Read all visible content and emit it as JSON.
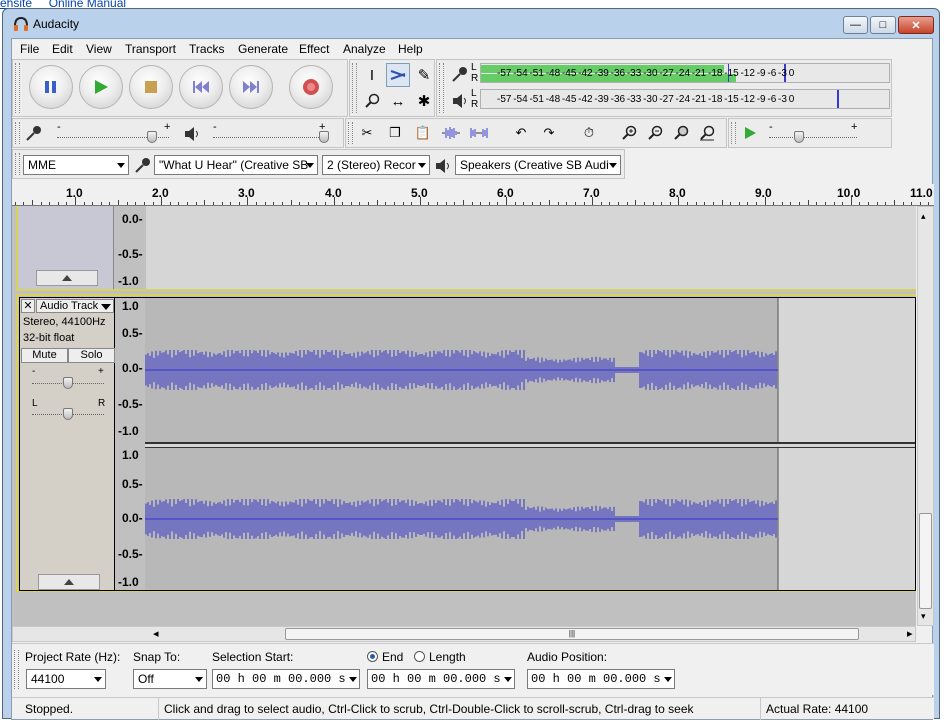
{
  "background": {
    "link_text": "ehsite     Online Manual"
  },
  "window": {
    "title": "Audacity",
    "btn_min": "—",
    "btn_max": "□",
    "btn_close": "✕"
  },
  "menu": [
    "File",
    "Edit",
    "View",
    "Transport",
    "Tracks",
    "Generate",
    "Effect",
    "Analyze",
    "Help"
  ],
  "meters": {
    "rec_ticks": "-57 -54 -51 -48 -45 -42 -39 -36 -33 -30 -27 -24 -21 -18 -15 -12  -9   -6   -3   0",
    "play_ticks": "-57 -54 -51 -48 -45 -42 -39 -36 -33 -30 -27 -24 -21 -18 -15 -12  -9   -6   -3   0",
    "rec_l": "L",
    "rec_r": "R",
    "play_l": "L",
    "play_r": "R"
  },
  "mixer": {
    "plus": "+",
    "minus": "-"
  },
  "devices": {
    "host": "MME",
    "input": "\"What U Hear\" (Creative SB",
    "channels": "2 (Stereo) Recor",
    "output": "Speakers (Creative SB Audi"
  },
  "ruler": {
    "labels": [
      "1.0",
      "2.0",
      "3.0",
      "4.0",
      "5.0",
      "6.0",
      "7.0",
      "8.0",
      "9.0",
      "10.0",
      "11.0"
    ]
  },
  "track1": {
    "scale": [
      "0.0-",
      "-0.5-",
      "-1.0"
    ]
  },
  "track2": {
    "close": "✕",
    "name": "Audio Track",
    "rate": "Stereo, 44100Hz",
    "format": "32-bit float",
    "mute": "Mute",
    "solo": "Solo",
    "gain_minus": "-",
    "gain_plus": "+",
    "pan_l": "L",
    "pan_r": "R",
    "scale_top": [
      "1.0",
      "0.5-",
      "0.0-",
      "-0.5-",
      "-1.0"
    ],
    "scale_bottom": [
      "1.0",
      "0.5-",
      "0.0-",
      "-0.5-",
      "-1.0"
    ]
  },
  "hscroll": {
    "left": "◂",
    "right": "▸",
    "grip": "|||"
  },
  "selection": {
    "rate_label": "Project Rate (Hz):",
    "rate_value": "44100",
    "snap_label": "Snap To:",
    "snap_value": "Off",
    "start_label": "Selection Start:",
    "end_label": "End",
    "length_label": "Length",
    "pos_label": "Audio Position:",
    "start_time": "00 h 00 m 00.000 s",
    "end_time": "00 h 00 m 00.000 s",
    "pos_time": "00 h 00 m 00.000 s"
  },
  "status": {
    "state": "Stopped.",
    "hint": "Click and drag to select audio, Ctrl-Click to scrub, Ctrl-Double-Click to scroll-scrub, Ctrl-drag to seek",
    "rate": "Actual Rate: 44100"
  }
}
